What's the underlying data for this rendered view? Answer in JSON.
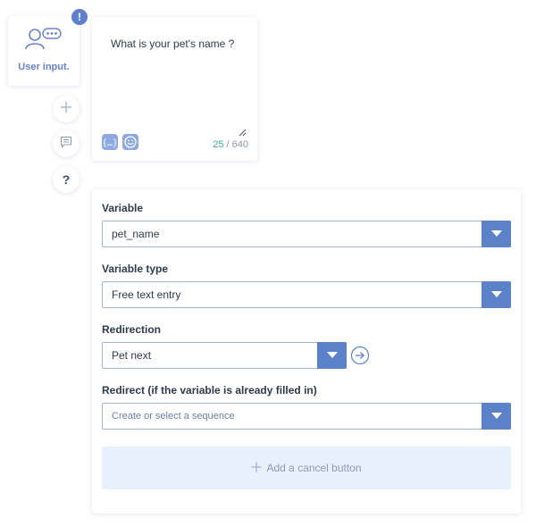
{
  "node": {
    "label": "User input.",
    "badge": "!",
    "icon": "user-chat-icon"
  },
  "side_buttons": {
    "add_icon": "plus-icon",
    "comment_icon": "comment-icon",
    "help_label": "?"
  },
  "message": {
    "text": "What is your pet's name ?",
    "char_count": "25",
    "char_separator": "/",
    "char_max": "640",
    "variable_icon": "braces-icon",
    "emoji_icon": "emoji-icon"
  },
  "form": {
    "variable": {
      "label": "Variable",
      "value": "pet_name"
    },
    "variable_type": {
      "label": "Variable type",
      "value": "Free text entry"
    },
    "redirection": {
      "label": "Redirection",
      "value": "Pet next"
    },
    "redirect_filled": {
      "label": "Redirect (if the variable is already filled in)",
      "placeholder": "Create or select a sequence"
    },
    "cancel_button": {
      "label": "Add a cancel button"
    }
  },
  "colors": {
    "accent": "#5b82c9",
    "count_current": "#3aa8a0",
    "cancel_bg": "#e8f0fd"
  }
}
